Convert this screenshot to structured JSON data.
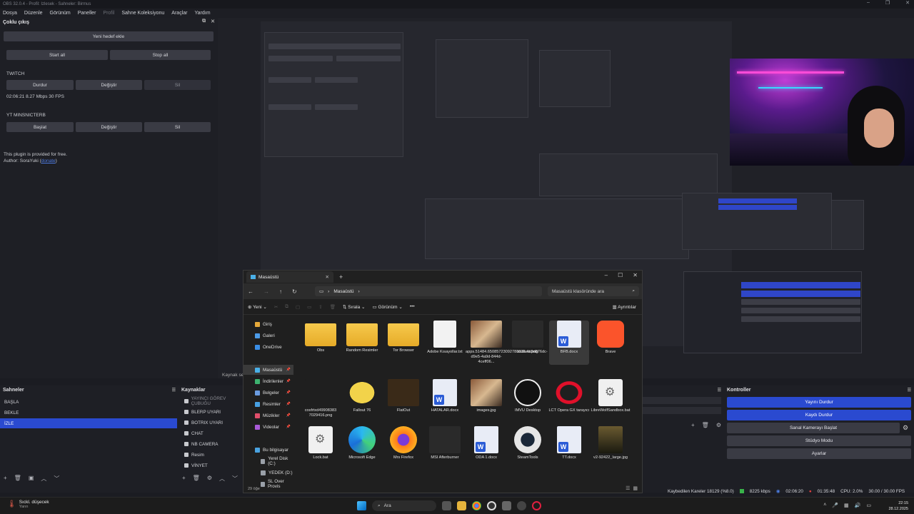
{
  "window": {
    "title": "OBS 32.0.4 - Profil: Izlesek - Sahneler: Birmus"
  },
  "menu": [
    "Dosya",
    "Düzenle",
    "Görünüm",
    "Paneller",
    "Profil",
    "Sahne Koleksiyonu",
    "Araçlar",
    "Yardım"
  ],
  "multi_output": {
    "title": "Çoklu çıkış",
    "add_target": "Yeni hedef ekle",
    "start_all": "Start all",
    "stop_all": "Stop all",
    "twitch": {
      "name": "TWITCH",
      "stop": "Durdur",
      "edit": "Değiştir",
      "delete": "Sil",
      "stats": "02:06:21  8.27 Mbps  30 FPS"
    },
    "yt": {
      "name": "YT MINSNICTERB",
      "start": "Başlat",
      "edit": "Değiştir",
      "delete": "Sil"
    },
    "footer_line1": "This plugin is provided for free.",
    "footer_author": "Author: SoraYuki (",
    "footer_link": "donate",
    "footer_close": ")"
  },
  "explorer": {
    "tab_title": "Masaüstü",
    "address": "Masaüstü",
    "search_placeholder": "Masaüstü klasöründe ara",
    "cmd": {
      "new": "Yeni",
      "sort": "Sırala",
      "view": "Görünüm",
      "more": "•••",
      "details": "Ayrıntılar"
    },
    "sidebar": [
      {
        "label": "Giriş",
        "color": "#e6a93a"
      },
      {
        "label": "Galeri",
        "color": "#4c9be8"
      },
      {
        "label": "OneDrive",
        "color": "#3a8ee6"
      },
      {
        "label": "Masaüstü",
        "color": "#4ab0e8"
      },
      {
        "label": "İndirilenler",
        "color": "#3db36f"
      },
      {
        "label": "Belgeler",
        "color": "#6a9be0"
      },
      {
        "label": "Resimler",
        "color": "#47a0e2"
      },
      {
        "label": "Müzikler",
        "color": "#e04e6a"
      },
      {
        "label": "Videolar",
        "color": "#a95ad8"
      },
      {
        "label": "Bu bilgisayar",
        "color": "#4aa3e0"
      },
      {
        "label": "Yerel Disk (C:)",
        "color": "#9aa0a8"
      },
      {
        "label": "YEDEK (D:)",
        "color": "#9aa0a8"
      },
      {
        "label": "SL Over Provis",
        "color": "#9aa0a8"
      }
    ],
    "files": [
      {
        "name": "Obs",
        "kind": "folder"
      },
      {
        "name": "Random Resimler",
        "kind": "folder-img"
      },
      {
        "name": "Tor Browser",
        "kind": "folder"
      },
      {
        "name": "Adobe Kısayollar.txt",
        "kind": "doc"
      },
      {
        "name": "apps.51484.65085723092788836.4a9d876dc-d9e5-4a9d-844d-4ceff06...",
        "kind": "img"
      },
      {
        "name": "asdasd.png",
        "kind": "dark"
      },
      {
        "name": "BFB.docx",
        "kind": "word"
      },
      {
        "name": "Brave",
        "kind": "brave"
      },
      {
        "name": "cosfrtxd49908383 7029416.png",
        "kind": "mola"
      },
      {
        "name": "Fallout 76",
        "kind": "fallout"
      },
      {
        "name": "FlatOut",
        "kind": "flatout"
      },
      {
        "name": "HATALAR.docx",
        "kind": "word"
      },
      {
        "name": "images.jpg",
        "kind": "img"
      },
      {
        "name": "IMVU Desktop",
        "kind": "imvu"
      },
      {
        "name": "LCT Opera GX tarayıcı",
        "kind": "opera"
      },
      {
        "name": "LibreWolfSandbox.bat",
        "kind": "gear"
      },
      {
        "name": "Lock.bat",
        "kind": "gear"
      },
      {
        "name": "Microsoft Edge",
        "kind": "edge"
      },
      {
        "name": "Mrs Firefox",
        "kind": "firefox"
      },
      {
        "name": "MSI Afterburner",
        "kind": "msi"
      },
      {
        "name": "ODA 1.docx",
        "kind": "word"
      },
      {
        "name": "SteamTools",
        "kind": "steam"
      },
      {
        "name": "TT.docx",
        "kind": "word"
      },
      {
        "name": "v2-92422_large.jpg",
        "kind": "v2"
      }
    ],
    "status": "29 öğe"
  },
  "scenes": {
    "title": "Sahneler",
    "items": [
      "BAŞLA",
      "BEKLE",
      "İZLE"
    ],
    "selected": 2
  },
  "sources": {
    "title": "Kaynaklar",
    "items": [
      "YAYINCI GÖREV ÇUBUĞU",
      "BLERP UYARI",
      "BOTRIX UYARI",
      "CHAT",
      "NB CAMERA",
      "Resim",
      "VİNYET"
    ]
  },
  "controls": {
    "title": "Kontroller",
    "stop_stream": "Yayını Durdur",
    "stop_record": "Kaydı Durdur",
    "virtual_cam": "Sanal Kamerayı Başlat",
    "studio": "Stüdyo Modu",
    "settings": "Ayarlar"
  },
  "status_bar": {
    "dropped": "Kaybedilen Kareler 18129 (%8.0)",
    "kbps": "8225 kbps",
    "live_time": "02:06:20",
    "rec_time": "01:35:48",
    "cpu": "CPU: 2.0%",
    "fps": "30.00 / 30.00 FPS"
  },
  "taskbar": {
    "weather_title": "Sıckl. düşecek",
    "weather_sub": "Yarın",
    "search": "Ara",
    "time": "22:15",
    "date": "28.12.2025"
  },
  "misc": {
    "source_label": "Kaynak se"
  }
}
